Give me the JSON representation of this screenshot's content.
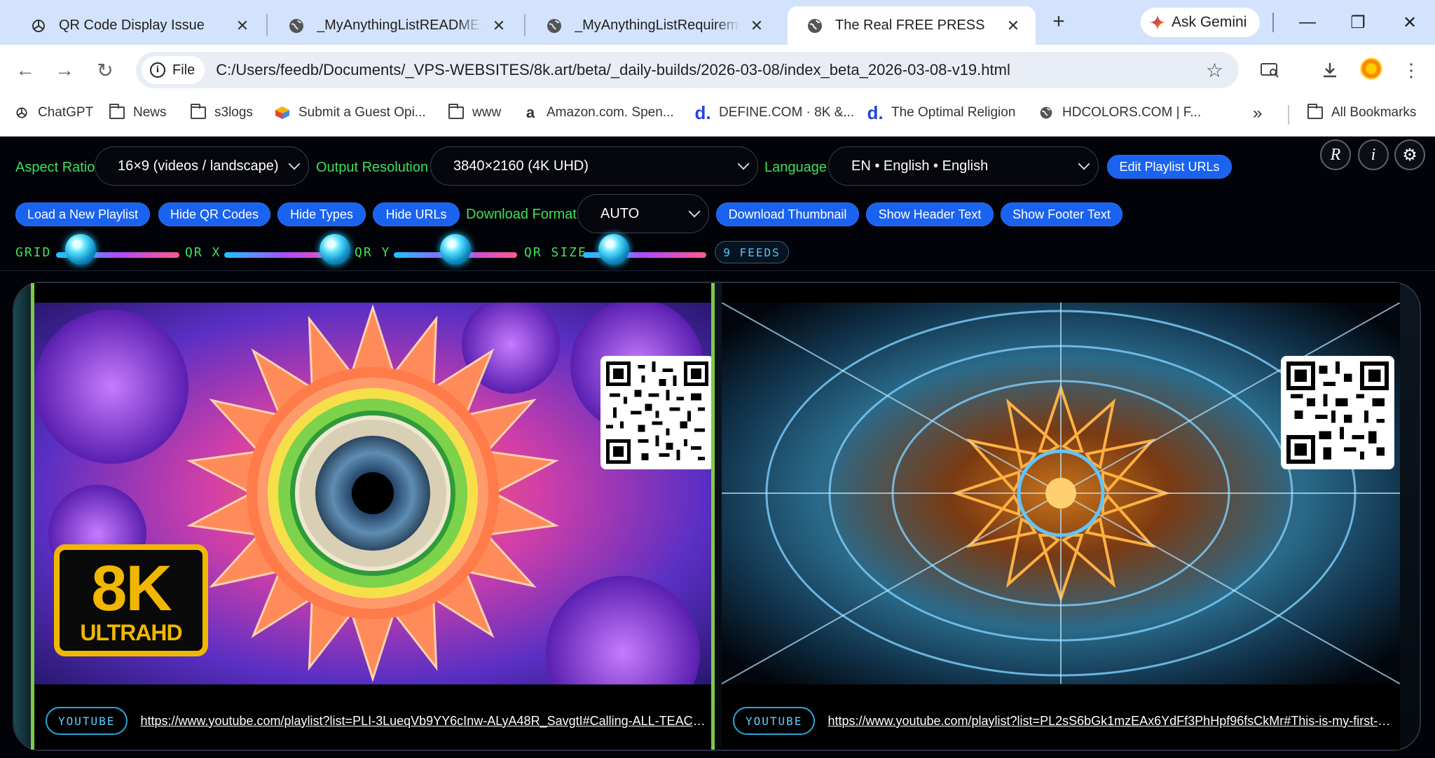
{
  "browser": {
    "tabs": [
      {
        "title": "QR Code Display Issue",
        "active": false
      },
      {
        "title": "_MyAnythingListREADME.htm",
        "active": false
      },
      {
        "title": "_MyAnythingListRequirements",
        "active": false
      },
      {
        "title": "The Real FREE PRESS",
        "active": true
      }
    ],
    "new_tab": "+",
    "gemini_label": "Ask Gemini",
    "window_controls": {
      "minimize": "—",
      "restore": "❐",
      "close": "✕"
    },
    "omnibox": {
      "scheme_chip": "File",
      "url": "C:/Users/feedb/Documents/_VPS-WEBSITES/8k.art/beta/_daily-builds/2026-03-08/index_beta_2026-03-08-v19.html"
    },
    "bookmarks": [
      {
        "label": "ChatGPT",
        "icon": "openai-icon"
      },
      {
        "label": "News",
        "icon": "folder-icon"
      },
      {
        "label": "s3logs",
        "icon": "folder-icon"
      },
      {
        "label": "Submit a Guest Opi...",
        "icon": "colorful-box-icon"
      },
      {
        "label": "www",
        "icon": "folder-icon"
      },
      {
        "label": "Amazon.com. Spen...",
        "icon": "amazon-icon"
      },
      {
        "label": "DEFINE.COM · 8K &...",
        "icon": "define-d-icon"
      },
      {
        "label": "The Optimal Religion",
        "icon": "define-d-icon"
      },
      {
        "label": "HDCOLORS.COM | F...",
        "icon": "globe-icon"
      }
    ],
    "bookmarks_more": "»",
    "all_bookmarks": "All Bookmarks"
  },
  "controls": {
    "aspect_ratio_label": "Aspect Ratio",
    "aspect_ratio_value": "16×9 (videos / landscape)",
    "output_resolution_label": "Output Resolution",
    "output_resolution_value": "3840×2160 (4K UHD)",
    "language_label": "Language",
    "language_value": "EN • English • English",
    "edit_playlist_urls": "Edit Playlist URLs",
    "icon_buttons": {
      "r": "R",
      "i": "i",
      "settings": "⚙"
    },
    "load_playlist": "Load a New Playlist",
    "hide_qr": "Hide QR Codes",
    "hide_types": "Hide Types",
    "hide_urls": "Hide URLs",
    "download_format_label": "Download Format",
    "download_format_value": "AUTO",
    "download_thumbnail": "Download Thumbnail",
    "show_header_text": "Show Header Text",
    "show_footer_text": "Show Footer Text",
    "sliders": [
      {
        "label": "GRID",
        "value": 0.2
      },
      {
        "label": "QR X",
        "value": 0.9
      },
      {
        "label": "QR Y",
        "value": 0.5
      },
      {
        "label": "QR SIZE",
        "value": 0.25
      }
    ],
    "feeds_badge": "9 FEEDS"
  },
  "feeds": [
    {
      "type": "YOUTUBE",
      "url": "https://www.youtube.com/playlist?list=PLI-3LueqVb9YY6cInw-ALyA48R_SavgtI#Calling-ALL-TEACHERS...",
      "badge": {
        "big": "8K",
        "small": "ULTRAHD"
      }
    },
    {
      "type": "YOUTUBE",
      "url": "https://www.youtube.com/playlist?list=PL2sS6bGk1mzEAx6YdFf3PhHpf96fsCkMr#This-is-my-first-play..."
    }
  ],
  "colors": {
    "accent_green": "#3ee05a",
    "button_blue": "#1a62f0",
    "chip_cyan": "#5cd0ff",
    "app_bg": "#010308"
  }
}
